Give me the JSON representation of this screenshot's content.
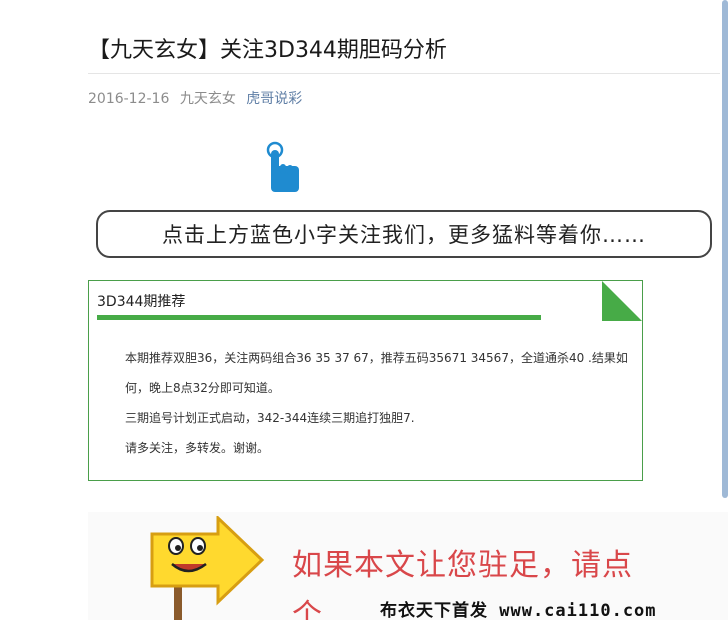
{
  "article": {
    "title": "【九天玄女】关注3D344期胆码分析",
    "date": "2016-12-16",
    "author": "九天玄女",
    "account_link": "虎哥说彩"
  },
  "banner": {
    "notice": "点击上方蓝色小字关注我们，更多猛料等着你……"
  },
  "recommend": {
    "title": "3D344期推荐",
    "lines": [
      "本期推荐双胆36，关注两码组合36 35 37 67，推荐五码35671 34567，全道通杀40 .结果如何，晚上8点32分即可知道。",
      "三期追号计划正式启动，342-344连续三期追打独胆7.",
      "请多关注，多转发。谢谢。"
    ]
  },
  "footer": {
    "slogan": "如果本文让您驻足，请点",
    "slogan_tail": "个",
    "brand": "布衣天下首发 www.cai110.com"
  },
  "colors": {
    "accent_green": "#47ab47",
    "link_blue": "#607fa6",
    "footer_red": "#d9474a",
    "finger_blue": "#1f8bd0"
  }
}
